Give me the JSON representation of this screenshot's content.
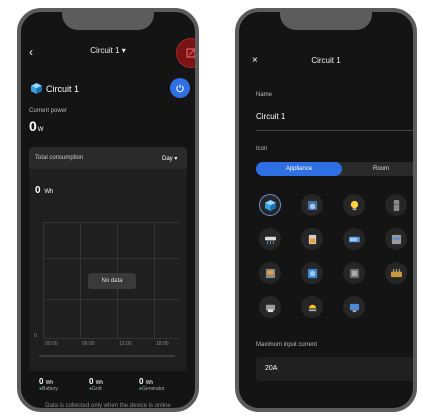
{
  "left_screen": {
    "header": {
      "back_icon": "back-chevron-icon",
      "title": "Circuit 1 ▾",
      "edit_icon": "edit-icon"
    },
    "device": {
      "name": "Circuit 1",
      "icon": "cube-icon",
      "power_color": "#2f6fe4"
    },
    "current_power": {
      "label": "Current power",
      "value": "0",
      "unit": "W"
    },
    "consumption": {
      "title": "Total consumption",
      "range": "Day ▾",
      "value": "0",
      "unit": "Wh",
      "y_tick": "0",
      "x_ticks": [
        "00:00",
        "06:00",
        "12:00",
        "18:00"
      ],
      "no_data": "No data"
    },
    "stats": [
      {
        "value": "0",
        "unit": "Wh",
        "label": "Battery"
      },
      {
        "value": "0",
        "unit": "Wh",
        "label": "Grid"
      },
      {
        "value": "0",
        "unit": "Wh",
        "label": "Generator"
      }
    ],
    "footer": "Data is collected only when the device is online"
  },
  "right_screen": {
    "header": {
      "close": "×",
      "title": "Circuit 1",
      "confirm": "✓"
    },
    "name_label": "Name",
    "name_value": "Circuit 1",
    "icon_label": "Icon",
    "tabs": {
      "active": "Appliance",
      "inactive": "Room"
    },
    "icons": [
      "cube-icon",
      "washer-icon",
      "bulb-icon",
      "fridge-icon",
      "air-conditioner-icon",
      "oven-icon",
      "tv-icon",
      "monitor-icon",
      "microwave-icon",
      "dryer-icon",
      "dishwasher-icon",
      "heater-icon",
      "printer-icon",
      "lamp-icon",
      "computer-icon"
    ],
    "max_input_label": "Maximum input current",
    "max_input_value": "20A"
  }
}
